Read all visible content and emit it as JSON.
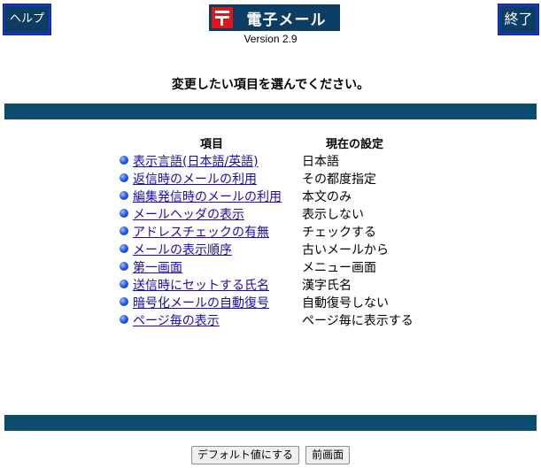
{
  "header": {
    "help_label": "ヘルプ",
    "exit_label": "終了",
    "app_title": "電子メール",
    "version": "Version 2.9",
    "colors": {
      "band": "#0c4a6e",
      "logo_bg": "#0c3d64",
      "post_mark": "#e0161b"
    }
  },
  "instruction": "変更したい項目を選んでください。",
  "table": {
    "col_item": "項目",
    "col_current": "現在の設定",
    "rows": [
      {
        "item": "表示言語(日本語/英語)",
        "current": "日本語"
      },
      {
        "item": "返信時のメールの利用",
        "current": "その都度指定"
      },
      {
        "item": "編集発信時のメールの利用",
        "current": "本文のみ"
      },
      {
        "item": "メールヘッダの表示",
        "current": "表示しない"
      },
      {
        "item": "アドレスチェックの有無",
        "current": "チェックする"
      },
      {
        "item": "メールの表示順序",
        "current": "古いメールから"
      },
      {
        "item": "第一画面",
        "current": "メニュー画面"
      },
      {
        "item": "送信時にセットする氏名",
        "current": "漢字氏名"
      },
      {
        "item": "暗号化メールの自動復号",
        "current": "自動復号しない"
      },
      {
        "item": "ページ毎の表示",
        "current": "ページ毎に表示する"
      }
    ]
  },
  "footer": {
    "default_label": "デフォルト値にする",
    "prev_label": "前画面"
  }
}
